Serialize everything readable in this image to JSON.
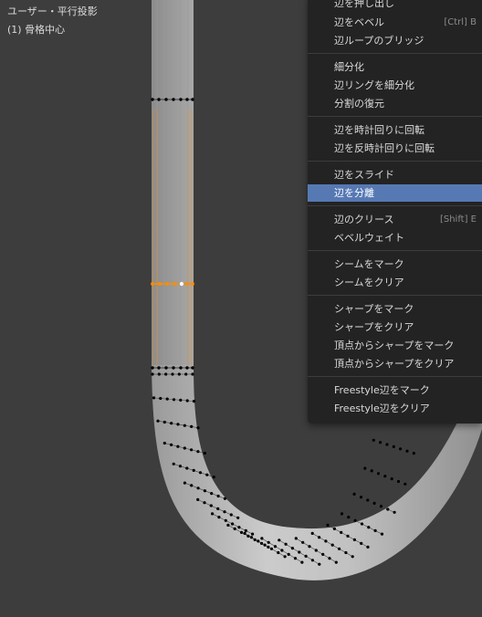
{
  "viewport": {
    "view_name": "ユーザー・平行投影",
    "object_info": "(1) 骨格中心"
  },
  "context_menu": {
    "items": [
      {
        "label": "辺を押し出し",
        "shortcut": ""
      },
      {
        "label": "辺をベベル",
        "shortcut": "[Ctrl] B"
      },
      {
        "label": "辺ループのブリッジ",
        "shortcut": ""
      },
      {
        "label": "細分化",
        "shortcut": ""
      },
      {
        "label": "辺リングを細分化",
        "shortcut": ""
      },
      {
        "label": "分割の復元",
        "shortcut": ""
      },
      {
        "label": "辺を時計回りに回転",
        "shortcut": ""
      },
      {
        "label": "辺を反時計回りに回転",
        "shortcut": ""
      },
      {
        "label": "辺をスライド",
        "shortcut": ""
      },
      {
        "label": "辺を分離",
        "shortcut": ""
      },
      {
        "label": "辺のクリース",
        "shortcut": "[Shift] E"
      },
      {
        "label": "ベベルウェイト",
        "shortcut": ""
      },
      {
        "label": "シームをマーク",
        "shortcut": ""
      },
      {
        "label": "シームをクリア",
        "shortcut": ""
      },
      {
        "label": "シャープをマーク",
        "shortcut": ""
      },
      {
        "label": "シャープをクリア",
        "shortcut": ""
      },
      {
        "label": "頂点からシャープをマーク",
        "shortcut": ""
      },
      {
        "label": "頂点からシャープをクリア",
        "shortcut": ""
      },
      {
        "label": "Freestyle辺をマーク",
        "shortcut": ""
      },
      {
        "label": "Freestyle辺をクリア",
        "shortcut": ""
      }
    ]
  },
  "colors": {
    "background": "#3d3d3d",
    "menu_background": "#232323",
    "highlight": "#5679b4",
    "selected_edge": "#ff8c00",
    "vertex": "#000000"
  }
}
